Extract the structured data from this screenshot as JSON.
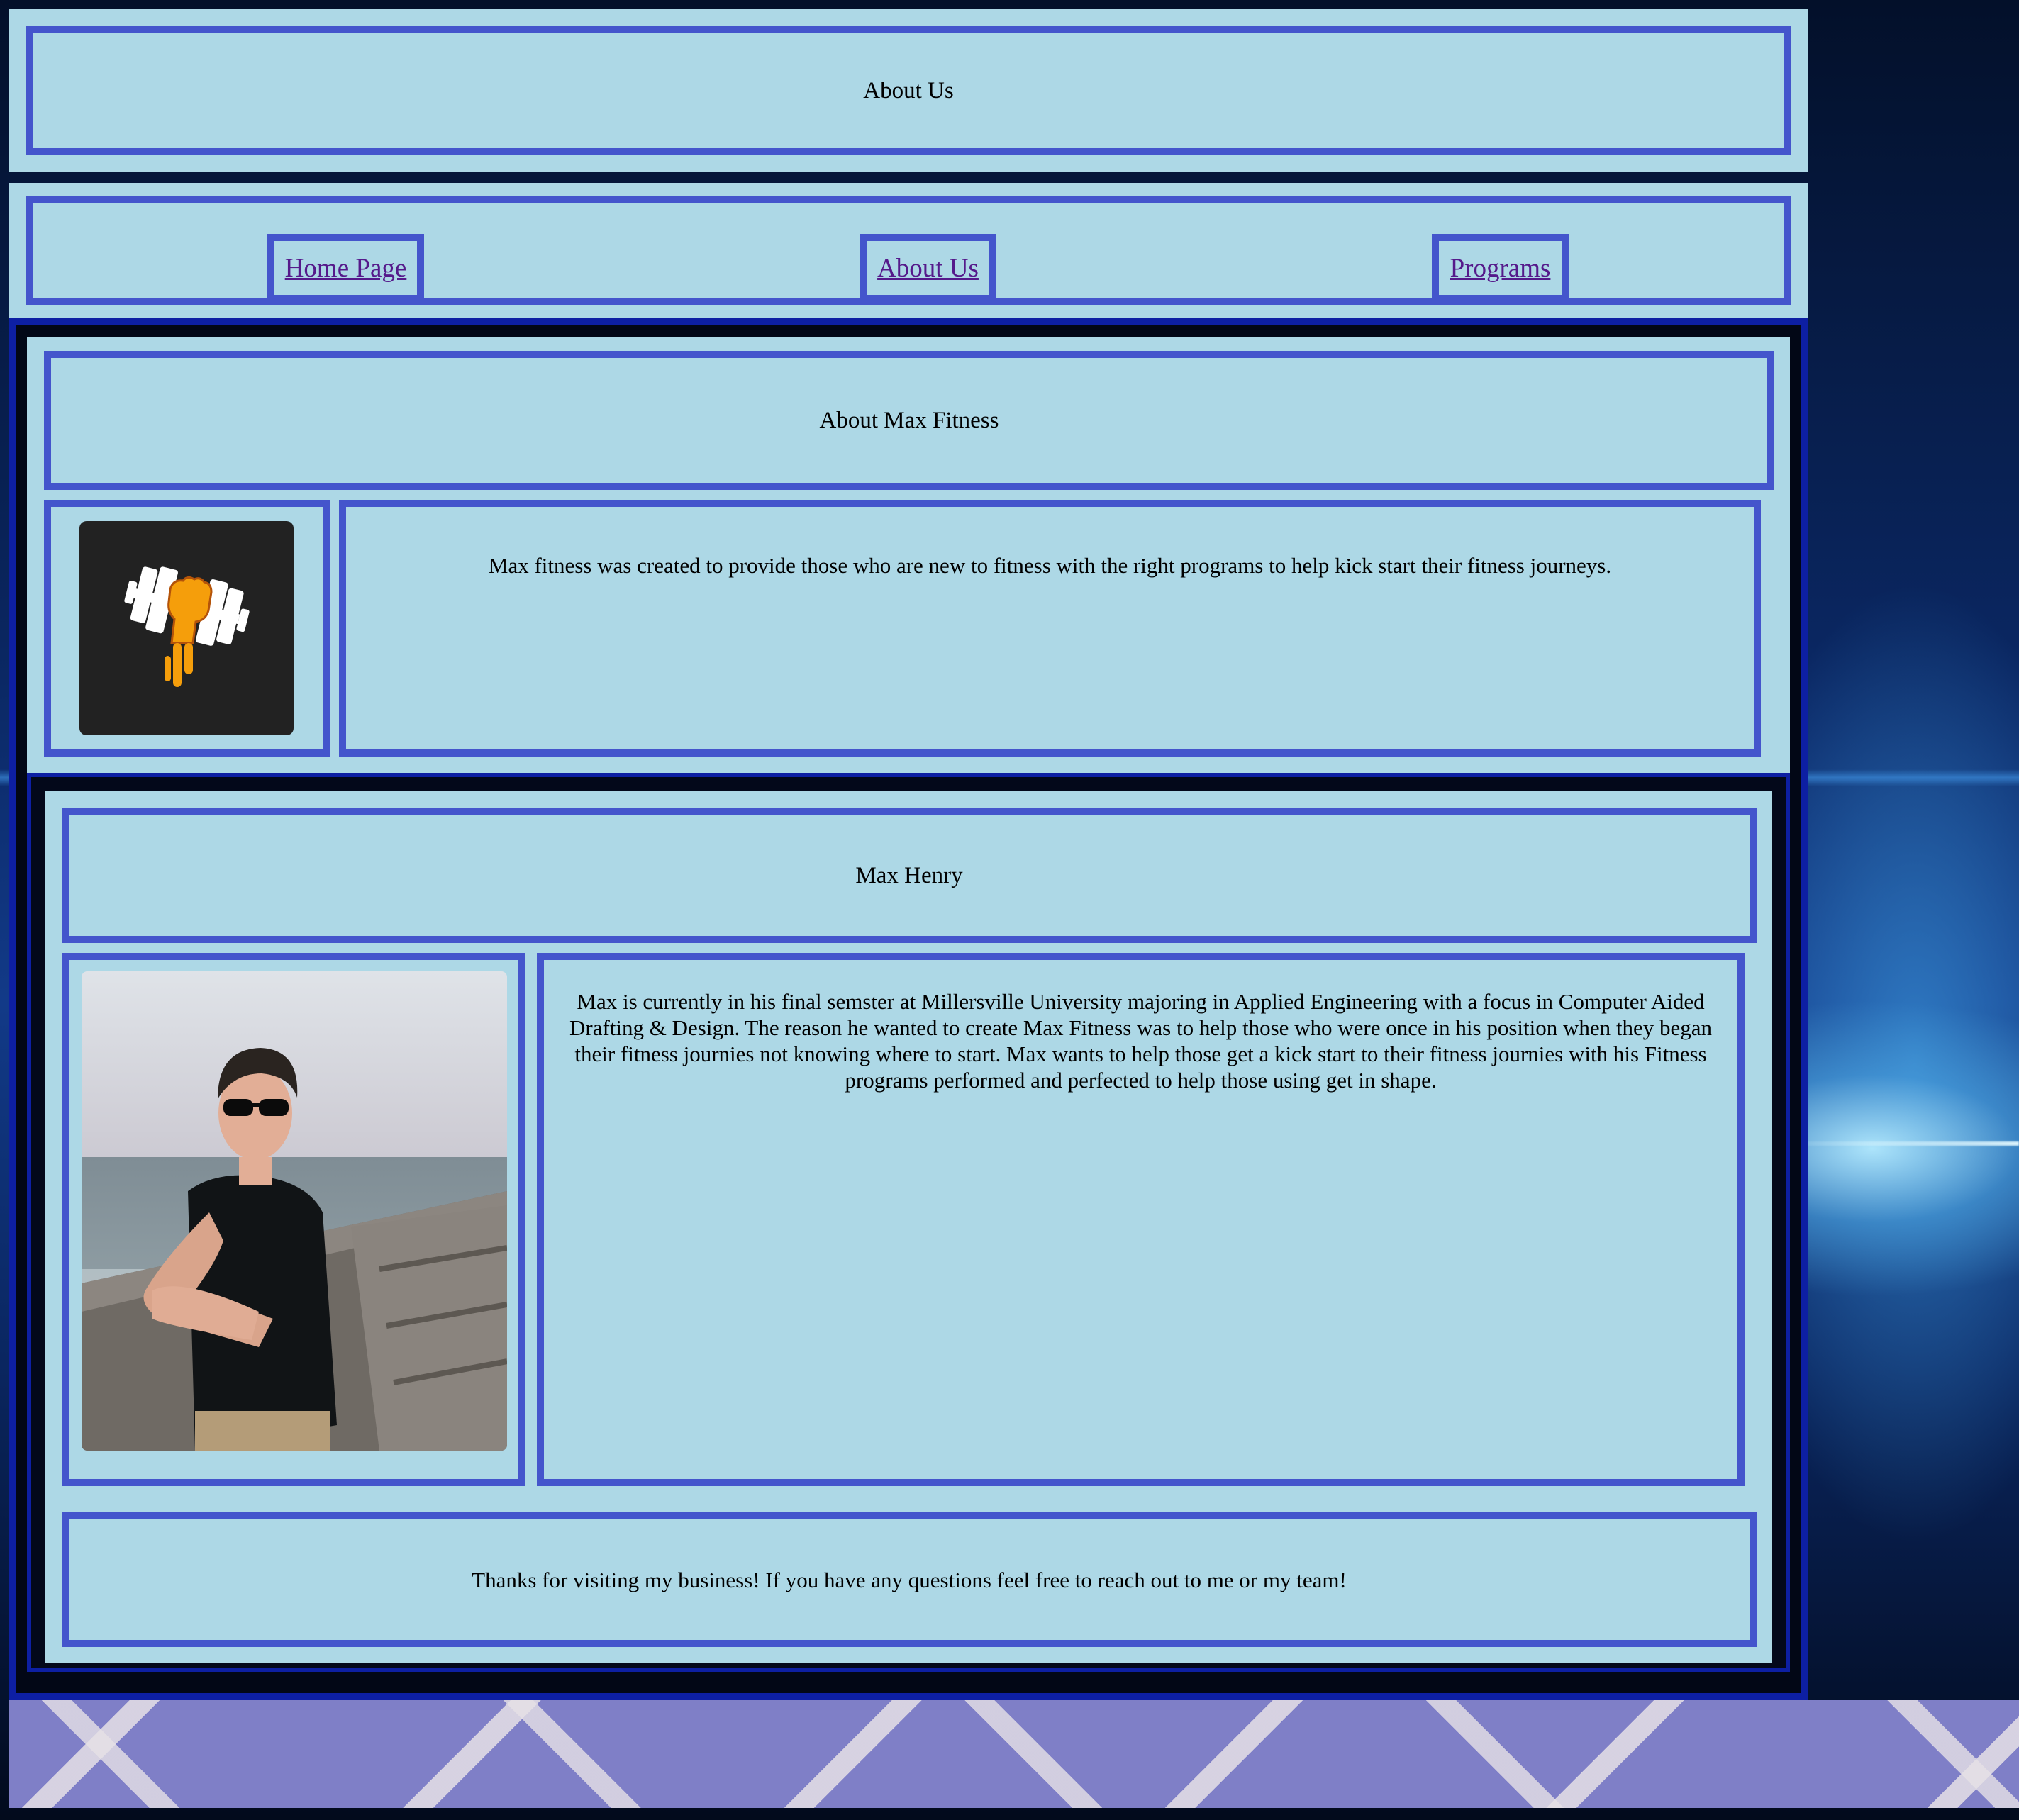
{
  "header": {
    "title": "About Us"
  },
  "nav": {
    "items": [
      {
        "label": "Home Page"
      },
      {
        "label": "About Us"
      },
      {
        "label": "Programs"
      }
    ]
  },
  "about": {
    "title": "About Max Fitness",
    "logo_icon": "dumbbell-fist-icon",
    "description": "Max fitness was created to provide those who are new to fitness with the right programs to help kick start their fitness journeys."
  },
  "team": {
    "name": "Max Henry",
    "bio": "Max is currently in his final semster at Millersville University majoring in Applied Engineering with a focus in Computer Aided Drafting & Design. The reason he wanted to create Max Fitness was to help those who were once in his position when they began their fitness journies not knowing where to start. Max wants to help those get a kick start to their fitness journies with his Fitness programs performed and perfected to help those using get in shape."
  },
  "footer": {
    "message": "Thanks for visiting my business! If you have any questions feel free to reach out to me or my team!"
  },
  "colors": {
    "panel": "#add8e6",
    "border": "#4455cc",
    "link": "#551a8b",
    "logo_accent": "#f59e0b"
  }
}
